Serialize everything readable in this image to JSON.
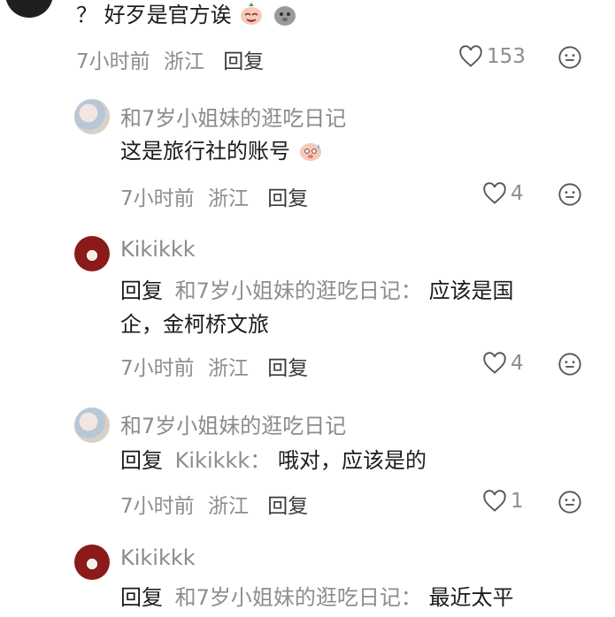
{
  "comments": [
    {
      "text": "？ 好歹是官方诶",
      "time": "7小时前",
      "location": "浙江",
      "reply": "回复",
      "likes": "153"
    },
    {
      "user": "和7岁小姐妹的逛吃日记",
      "text": "这是旅行社的账号",
      "time": "7小时前",
      "location": "浙江",
      "reply": "回复",
      "likes": "4"
    },
    {
      "user": "Kikikkk",
      "reply_prefix": "回复",
      "reply_to": "和7岁小姐妹的逛吃日记：",
      "text_line1": "应该是国",
      "text_line2": "企，金柯桥文旅",
      "time": "7小时前",
      "location": "浙江",
      "reply": "回复",
      "likes": "4"
    },
    {
      "user": "和7岁小姐妹的逛吃日记",
      "reply_prefix": "回复",
      "reply_to": "Kikikkk：",
      "text": "哦对，应该是的",
      "time": "7小时前",
      "location": "浙江",
      "reply": "回复",
      "likes": "1"
    },
    {
      "user": "Kikikkk",
      "reply_prefix": "回复",
      "reply_to": "和7岁小姐妹的逛吃日记：",
      "text": "最近太平"
    }
  ],
  "icons": {
    "like": "heart-outline-icon",
    "emoji": "smiley-outline-icon"
  }
}
